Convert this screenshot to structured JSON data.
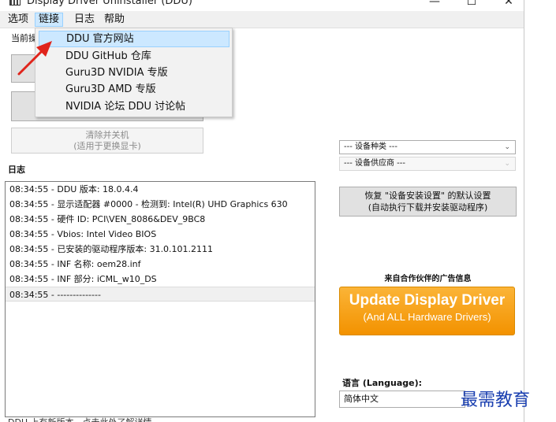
{
  "window": {
    "title": "Display Driver Uninstaller (DDU)",
    "minimize_glyph": "—",
    "maximize_glyph": "☐",
    "close_glyph": "✕"
  },
  "menubar": {
    "items": [
      "选项",
      "链接",
      "日志",
      "帮助"
    ]
  },
  "links_menu": {
    "items": [
      "DDU 官方网站",
      "DDU GitHub 仓库",
      "Guru3D NVIDIA 专版",
      "Guru3D AMD 专版",
      "NVIDIA 论坛 DDU 讨论帖"
    ]
  },
  "left_panel": {
    "current_label": "当前操",
    "shutdown_button": {
      "line1": "清除并关机",
      "line2": "(适用于更换显卡)"
    }
  },
  "log": {
    "title": "日志",
    "lines": [
      "08:34:55 - DDU 版本: 18.0.4.4",
      "08:34:55 - 显示适配器 #0000 - 检测到: Intel(R) UHD Graphics 630",
      "08:34:55 - 硬件 ID: PCI\\VEN_8086&DEV_9BC8",
      "08:34:55 - Vbios: Intel Video BIOS",
      "08:34:55 - 已安装的驱动程序版本: 31.0.101.2111",
      "08:34:55 - INF 名称: oem28.inf",
      "08:34:55 - INF 部分: iCML_w10_DS",
      "08:34:55 - --------------"
    ]
  },
  "right_panel": {
    "device_type_placeholder": "--- 设备种类 ---",
    "device_vendor_placeholder": "--- 设备供应商 ---",
    "restore_button": {
      "line1": "恢复 \"设备安装设置\" 的默认设置",
      "line2": "(自动执行下载并安装驱动程序)"
    },
    "ad_label": "来自合作伙伴的广告信息",
    "ad_banner": {
      "main": "Update Display Driver",
      "sub": "(And ALL Hardware Drivers)"
    },
    "language_label": "语言 (Language):",
    "language_value": "简体中文"
  },
  "status_bar": {
    "text": "DDU 上有新版本，点击此处了解详情"
  },
  "watermark": "最需教育",
  "colors": {
    "menu_highlight": "#cce8ff",
    "ad_orange": "#f39200",
    "arrow_red": "#e0241b",
    "watermark_blue": "#1a3fb0"
  }
}
